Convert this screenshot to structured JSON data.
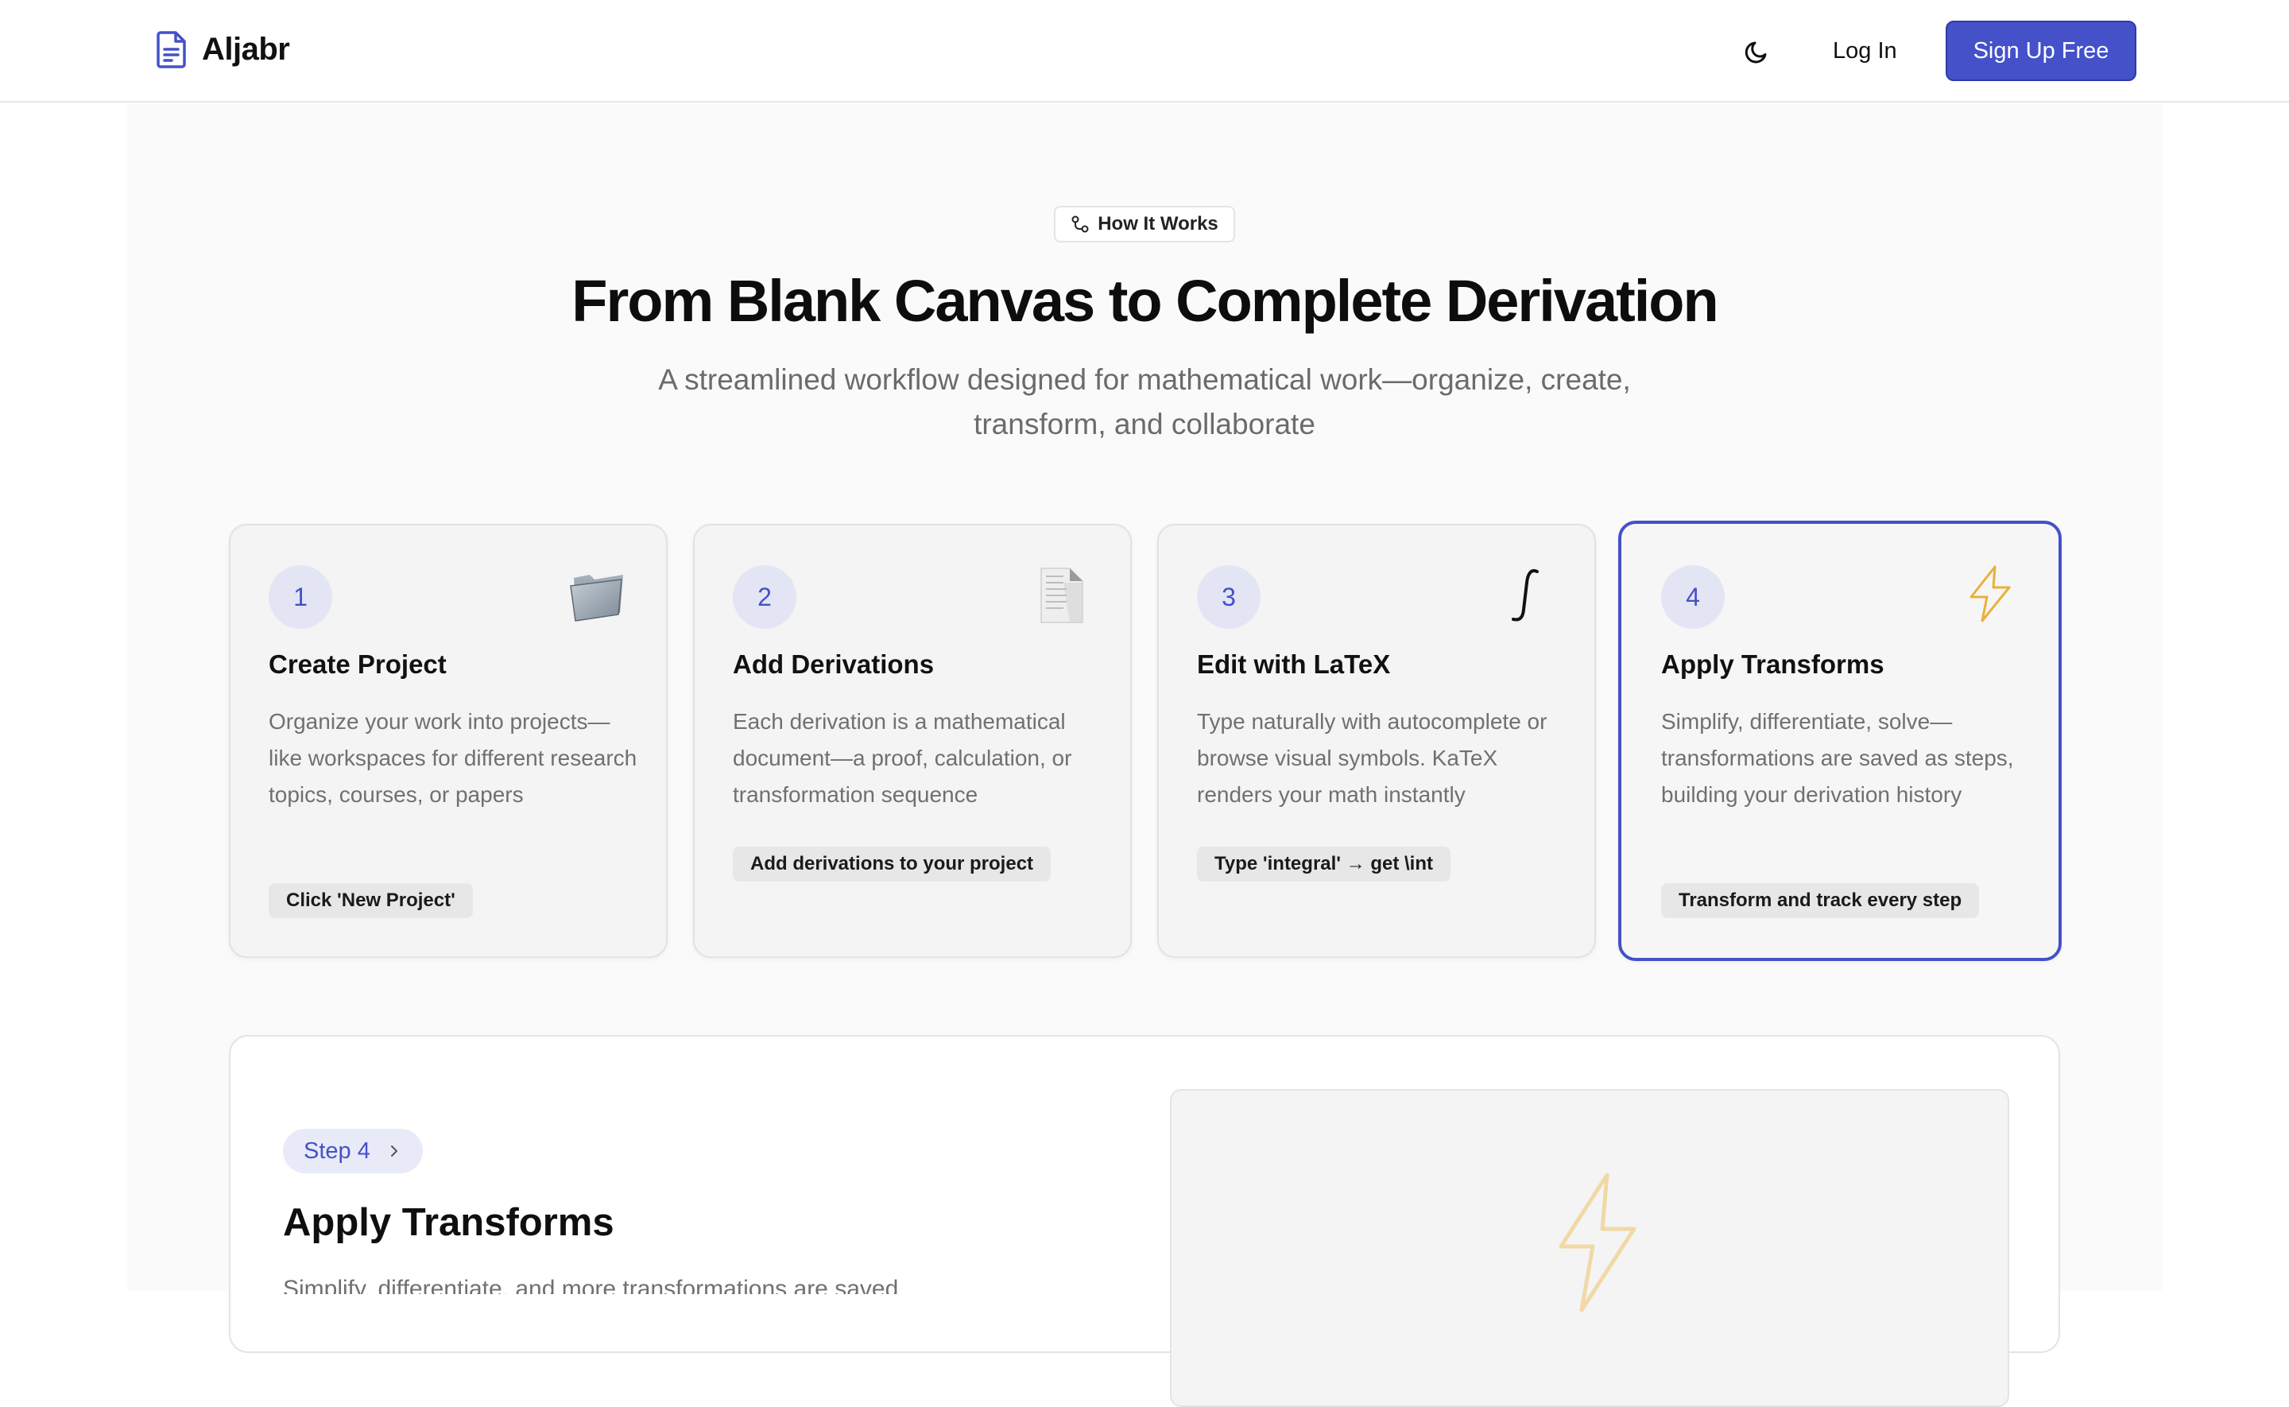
{
  "header": {
    "brand": "Aljabr",
    "brand_icon": "document-icon",
    "theme_icon": "moon-icon",
    "login_label": "Log In",
    "signup_label": "Sign Up Free"
  },
  "section": {
    "badge": "How It Works",
    "badge_icon": "workflow-icon",
    "title": "From Blank Canvas to Complete Derivation",
    "subtitle_line1": "A streamlined workflow designed for mathematical work—organize, create,",
    "subtitle_line2": "transform, and collaborate"
  },
  "steps": [
    {
      "number": "1",
      "icon": "folder-icon",
      "title": "Create Project",
      "description": "Organize your work into projects—like workspaces for different research topics, courses, or papers",
      "tag": "Click 'New Project'"
    },
    {
      "number": "2",
      "icon": "file-icon",
      "title": "Add Derivations",
      "description": "Each derivation is a mathematical document—a proof, calculation, or transformation sequence",
      "tag": "Add derivations to your project"
    },
    {
      "number": "3",
      "icon": "integral-icon",
      "title": "Edit with LaTeX",
      "description": "Type naturally with autocomplete or browse visual symbols. KaTeX renders your math instantly",
      "tag": "Type 'integral' → get \\int"
    },
    {
      "number": "4",
      "icon": "lightning-icon",
      "title": "Apply Transforms",
      "description": "Simplify, differentiate, solve—transformations are saved as steps, building your derivation history",
      "tag": "Transform and track every step"
    }
  ],
  "detail": {
    "step_label": "Step 4",
    "title": "Apply Transforms",
    "text": "Simplify, differentiate, and more transformations are saved",
    "visual_icon": "lightning-icon"
  },
  "colors": {
    "accent": "#4451c9",
    "accent_soft": "#e3e5f5",
    "lightning": "#e8b13a"
  }
}
